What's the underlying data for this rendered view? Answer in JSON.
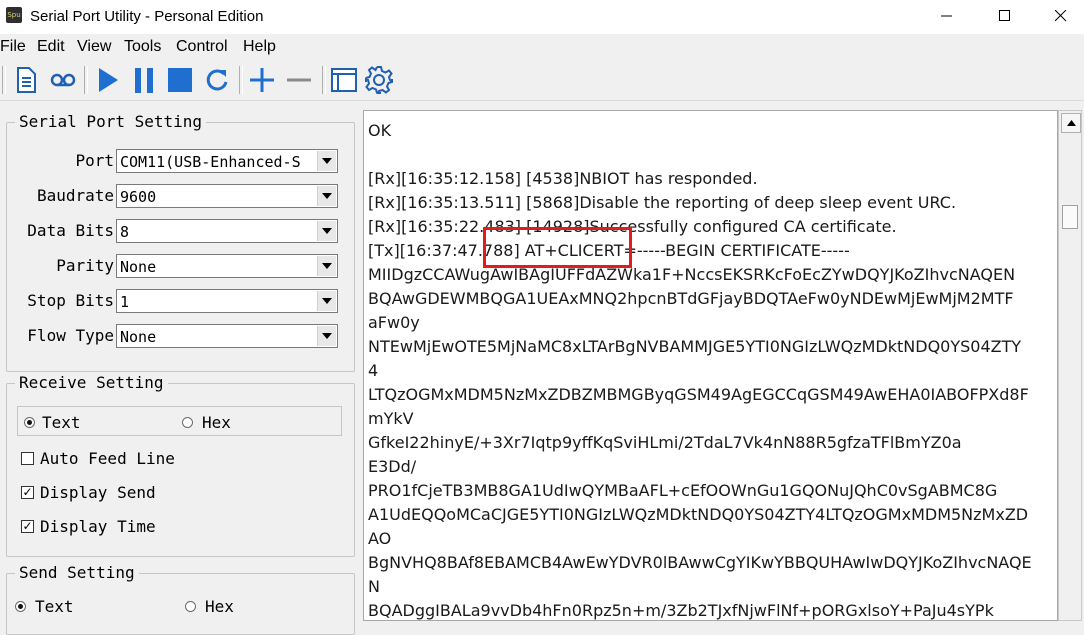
{
  "window": {
    "title": "Serial Port Utility - Personal Edition",
    "app_icon_text": "Spu",
    "minimize_icon": "minimize-icon",
    "maximize_icon": "maximize-icon",
    "close_icon": "close-icon"
  },
  "menu": {
    "items": [
      {
        "label": "File"
      },
      {
        "label": "Edit"
      },
      {
        "label": "View"
      },
      {
        "label": "Tools"
      },
      {
        "label": "Control"
      },
      {
        "label": "Help"
      }
    ]
  },
  "toolbar": {
    "icons": [
      "document-icon",
      "cassette-icon",
      "play-icon",
      "pause-icon",
      "stop-icon",
      "refresh-icon",
      "plus-icon",
      "minus-icon",
      "window-icon",
      "gear-icon"
    ],
    "accent_color": "#1e6fcf"
  },
  "serial_port_setting": {
    "title": "Serial Port Setting",
    "fields": [
      {
        "label": "Port",
        "value": "COM11(USB-Enhanced-S"
      },
      {
        "label": "Baudrate",
        "value": "9600"
      },
      {
        "label": "Data Bits",
        "value": "8"
      },
      {
        "label": "Parity",
        "value": "None"
      },
      {
        "label": "Stop Bits",
        "value": "1"
      },
      {
        "label": "Flow Type",
        "value": "None"
      }
    ]
  },
  "receive_setting": {
    "title": "Receive Setting",
    "mode_text": "Text",
    "mode_hex": "Hex",
    "selected_mode": "Text",
    "auto_feed_line": {
      "label": "Auto Feed Line",
      "checked": false
    },
    "display_send": {
      "label": "Display Send",
      "checked": true
    },
    "display_time": {
      "label": "Display Time",
      "checked": true
    }
  },
  "send_setting": {
    "title": "Send Setting",
    "mode_text": "Text",
    "mode_hex": "Hex",
    "selected_mode": "Text"
  },
  "log": {
    "lines": [
      "OK",
      "",
      "[Rx][16:35:12.158] [4538]NBIOT has responded.",
      "[Rx][16:35:13.511] [5868]Disable the reporting of deep sleep event URC.",
      "[Rx][16:35:22.483] [14928]Successfully configured CA certificate.",
      "[Tx][16:37:47.788] AT+CLICERT=-----BEGIN CERTIFICATE-----",
      "MIIDgzCCAWugAwIBAgIUFFdAZWka1F+NccsEKSRKcFoEcZYwDQYJKoZIhvcNAQEN",
      "BQAwGDEWMBQGA1UEAxMNQ2hpcnBTdGFjayBDQTAeFw0yNDEwMjEwMjM2MTF",
      "aFw0y",
      "NTEwMjEwOTE5MjNaMC8xLTArBgNVBAMMJGE5YTI0NGIzLWQzMDktNDQ0YS04ZTY",
      "4",
      "LTQzOGMxMDM5NzMxZDBZMBMGByqGSM49AgEGCCqGSM49AwEHA0IABOFPXd8F",
      "mYkV",
      "GfkeI22hinyE/+3Xr7Iqtp9yffKqSviHLmi/2TdaL7Vk4nN88R5gfzaTFlBmYZ0a",
      "E3Dd/",
      "PRO1fCjeTB3MB8GA1UdIwQYMBaAFL+cEfOOWnGu1GQONuJQhC0vSgABMC8G",
      "A1UdEQQoMCaCJGE5YTI0NGIzLWQzMDktNDQ0YS04ZTY4LTQzOGMxMDM5NzMxZD",
      "AO",
      "BgNVHQ8BAf8EBAMCB4AwEwYDVR0lBAwwCgYIKwYBBQUHAwIwDQYJKoZIhvcNAQE",
      "N",
      "BQADggIBALa9vvDb4hFn0Rpz5n+m/3Zb2TJxfNjwFlNf+pORGxlsoY+PaJu4sYPk"
    ]
  },
  "highlight_color": "#e31b1b"
}
